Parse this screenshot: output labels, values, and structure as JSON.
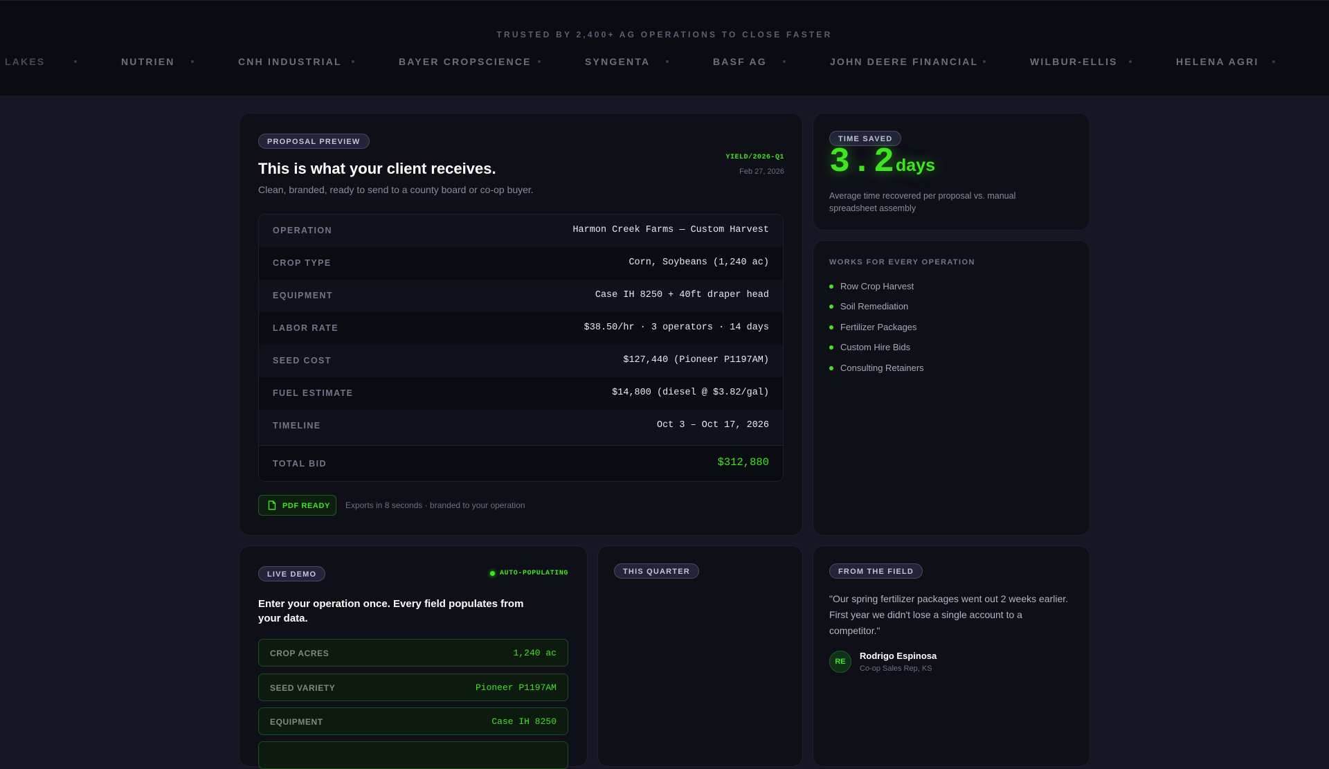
{
  "trust_bar": {
    "tagline": "TRUSTED BY 2,400+ AG OPERATIONS TO CLOSE FASTER",
    "logos": [
      "LAKES",
      "NUTRIEN",
      "CNH INDUSTRIAL",
      "BAYER CROPSCIENCE",
      "SYNGENTA",
      "BASF AG",
      "JOHN DEERE FINANCIAL",
      "WILBUR-ELLIS",
      "HELENA AGRI"
    ]
  },
  "proposal": {
    "badge": "PROPOSAL PREVIEW",
    "title": "This is what your client receives.",
    "subtitle": "Clean, branded, ready to send to a county board or co-op buyer.",
    "ref_code": "YIELD/2026-Q1",
    "date": "Feb 27, 2026",
    "rows": [
      {
        "label": "OPERATION",
        "value": "Harmon Creek Farms — Custom Harvest"
      },
      {
        "label": "CROP TYPE",
        "value": "Corn, Soybeans (1,240 ac)"
      },
      {
        "label": "EQUIPMENT",
        "value": "Case IH 8250 + 40ft draper head"
      },
      {
        "label": "LABOR RATE",
        "value": "$38.50/hr · 3 operators · 14 days"
      },
      {
        "label": "SEED COST",
        "value": "$127,440 (Pioneer P1197AM)"
      },
      {
        "label": "FUEL ESTIMATE",
        "value": "$14,800 (diesel @ $3.82/gal)"
      },
      {
        "label": "TIMELINE",
        "value": "Oct 3 – Oct 17, 2026"
      }
    ],
    "total_label": "TOTAL BID",
    "total_value": "$312,880",
    "pdf_badge": "PDF READY",
    "pdf_note": "Exports in 8 seconds · branded to your operation"
  },
  "time_saved": {
    "badge": "TIME SAVED",
    "value": "3.2",
    "unit": "days",
    "description": "Average time recovered per proposal vs. manual spreadsheet assembly"
  },
  "works_for": {
    "heading": "WORKS FOR EVERY OPERATION",
    "items": [
      "Row Crop Harvest",
      "Soil Remediation",
      "Fertilizer Packages",
      "Custom Hire Bids",
      "Consulting Retainers"
    ]
  },
  "live_demo": {
    "badge": "LIVE DEMO",
    "status": "AUTO-POPULATING",
    "heading": "Enter your operation once. Every field populates from your data.",
    "fields": [
      {
        "label": "CROP ACRES",
        "value": "1,240 ac"
      },
      {
        "label": "SEED VARIETY",
        "value": "Pioneer P1197AM"
      },
      {
        "label": "EQUIPMENT",
        "value": "Case IH 8250"
      }
    ]
  },
  "this_quarter": {
    "badge": "THIS QUARTER"
  },
  "testimonial": {
    "badge": "FROM THE FIELD",
    "quote": "\"Our spring fertilizer packages went out 2 weeks earlier. First year we didn't lose a single account to a competitor.\"",
    "initials": "RE",
    "name": "Rodrigo Espinosa",
    "role": "Co-op Sales Rep, KS"
  },
  "colors": {
    "accent_green": "#3ee61e",
    "background": "#161625",
    "card": "#0f0f18"
  }
}
